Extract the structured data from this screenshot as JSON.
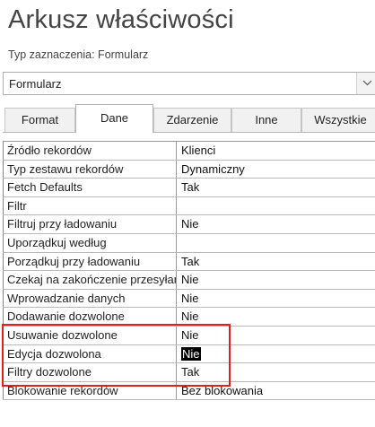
{
  "title": "Arkusz właściwości",
  "selection_type": "Typ zaznaczenia:  Formularz",
  "object_selector": {
    "value": "Formularz",
    "icon": "chevron-down-icon"
  },
  "tabs": [
    {
      "label": "Format"
    },
    {
      "label": "Dane",
      "active": true
    },
    {
      "label": "Zdarzenie"
    },
    {
      "label": "Inne"
    },
    {
      "label": "Wszystkie"
    }
  ],
  "properties": [
    {
      "label": "Źródło rekordów",
      "value": "Klienci"
    },
    {
      "label": "Typ zestawu rekordów",
      "value": "Dynamiczny"
    },
    {
      "label": "Fetch Defaults",
      "value": "Tak"
    },
    {
      "label": "Filtr",
      "value": ""
    },
    {
      "label": "Filtruj przy ładowaniu",
      "value": "Nie"
    },
    {
      "label": "Uporządkuj według",
      "value": ""
    },
    {
      "label": "Porządkuj przy ładowaniu",
      "value": "Tak"
    },
    {
      "label": "Czekaj na zakończenie przesyłania",
      "value": "Nie"
    },
    {
      "label": "Wprowadzanie danych",
      "value": "Nie"
    },
    {
      "label": "Dodawanie dozwolone",
      "value": "Nie"
    },
    {
      "label": "Usuwanie dozwolone",
      "value": "Nie"
    },
    {
      "label": "Edycja dozwolona",
      "value": "Nie",
      "selected": true
    },
    {
      "label": "Filtry dozwolone",
      "value": "Tak"
    },
    {
      "label": "Blokowanie rekordów",
      "value": "Bez blokowania"
    }
  ],
  "highlight_color": "#e02020"
}
